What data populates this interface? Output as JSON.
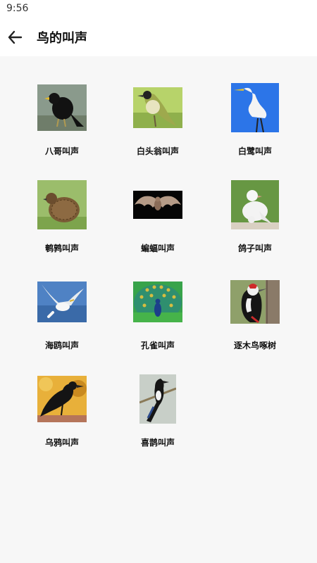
{
  "status_bar": {
    "time": "9:56"
  },
  "header": {
    "title": "鸟的叫声",
    "back_icon": "arrow-left-icon"
  },
  "birds": [
    {
      "label": "八哥叫声",
      "image": "myna-photo"
    },
    {
      "label": "白头翁叫声",
      "image": "bulbul-photo"
    },
    {
      "label": "白鹭叫声",
      "image": "egret-photo"
    },
    {
      "label": "鹌鹑叫声",
      "image": "quail-photo"
    },
    {
      "label": "蝙蝠叫声",
      "image": "bat-photo"
    },
    {
      "label": "鸽子叫声",
      "image": "dove-photo"
    },
    {
      "label": "海鸥叫声",
      "image": "seagull-photo"
    },
    {
      "label": "孔雀叫声",
      "image": "peacock-photo"
    },
    {
      "label": "逐木鸟啄树",
      "image": "woodpecker-photo"
    },
    {
      "label": "乌鸦叫声",
      "image": "crow-photo"
    },
    {
      "label": "喜鹊叫声",
      "image": "magpie-photo"
    }
  ]
}
